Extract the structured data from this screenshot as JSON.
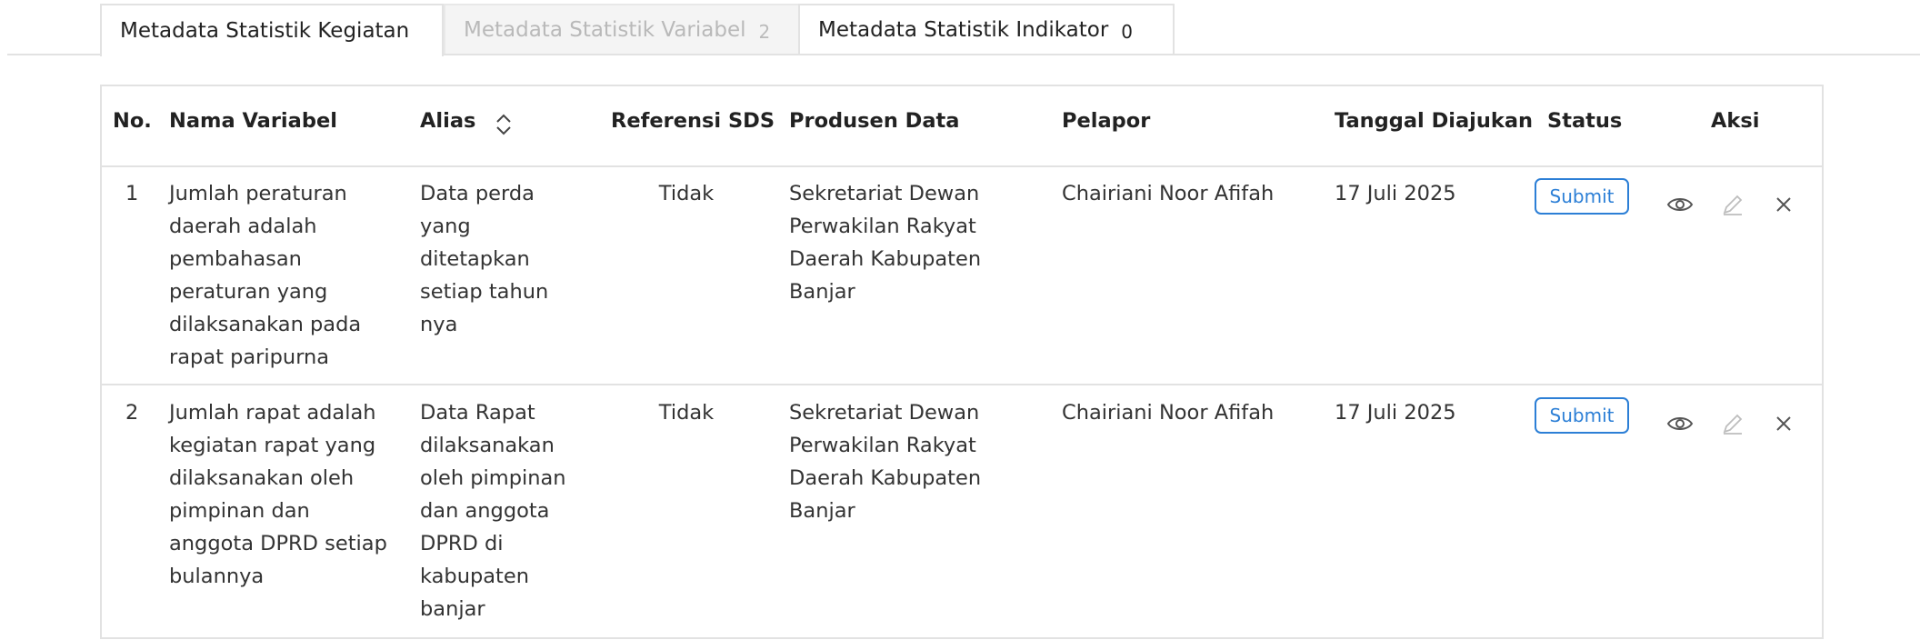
{
  "tabs": [
    {
      "label": "Metadata Statistik Kegiatan",
      "count": "",
      "state": "active"
    },
    {
      "label": "Metadata Statistik Variabel",
      "count": "2",
      "state": "inactive"
    },
    {
      "label": "Metadata Statistik Indikator",
      "count": "0",
      "state": "normal"
    }
  ],
  "table": {
    "headers": {
      "no": "No.",
      "nama": "Nama Variabel",
      "alias": "Alias",
      "sds": "Referensi SDS",
      "produsen": "Produsen Data",
      "pelapor": "Pelapor",
      "tanggal": "Tanggal Diajukan",
      "status": "Status",
      "aksi": "Aksi"
    },
    "rows": [
      {
        "no": "1",
        "nama": "Jumlah peraturan daerah adalah pembahasan peraturan yang dilaksanakan pada rapat paripurna",
        "alias": "Data perda yang ditetapkan setiap tahun nya",
        "sds": "Tidak",
        "produsen": "Sekretariat Dewan Perwakilan Rakyat Daerah Kabupaten Banjar",
        "pelapor": "Chairiani Noor Afifah",
        "tanggal": "17 Juli 2025",
        "status": "Submit"
      },
      {
        "no": "2",
        "nama": "Jumlah rapat adalah kegiatan rapat yang dilaksanakan oleh pimpinan dan anggota DPRD setiap bulannya",
        "alias": "Data Rapat dilaksanakan oleh pimpinan dan anggota DPRD di kabupaten banjar",
        "sds": "Tidak",
        "produsen": "Sekretariat Dewan Perwakilan Rakyat Daerah Kabupaten Banjar",
        "pelapor": "Chairiani Noor Afifah",
        "tanggal": "17 Juli 2025",
        "status": "Submit"
      }
    ]
  },
  "icons": {
    "sort": "sort-updown-icon",
    "view": "eye-icon",
    "edit": "pencil-icon",
    "delete": "close-icon"
  },
  "colors": {
    "accent": "#2c7fd6",
    "border": "#e2e2e2",
    "disabled_text": "#b9b9b9"
  }
}
